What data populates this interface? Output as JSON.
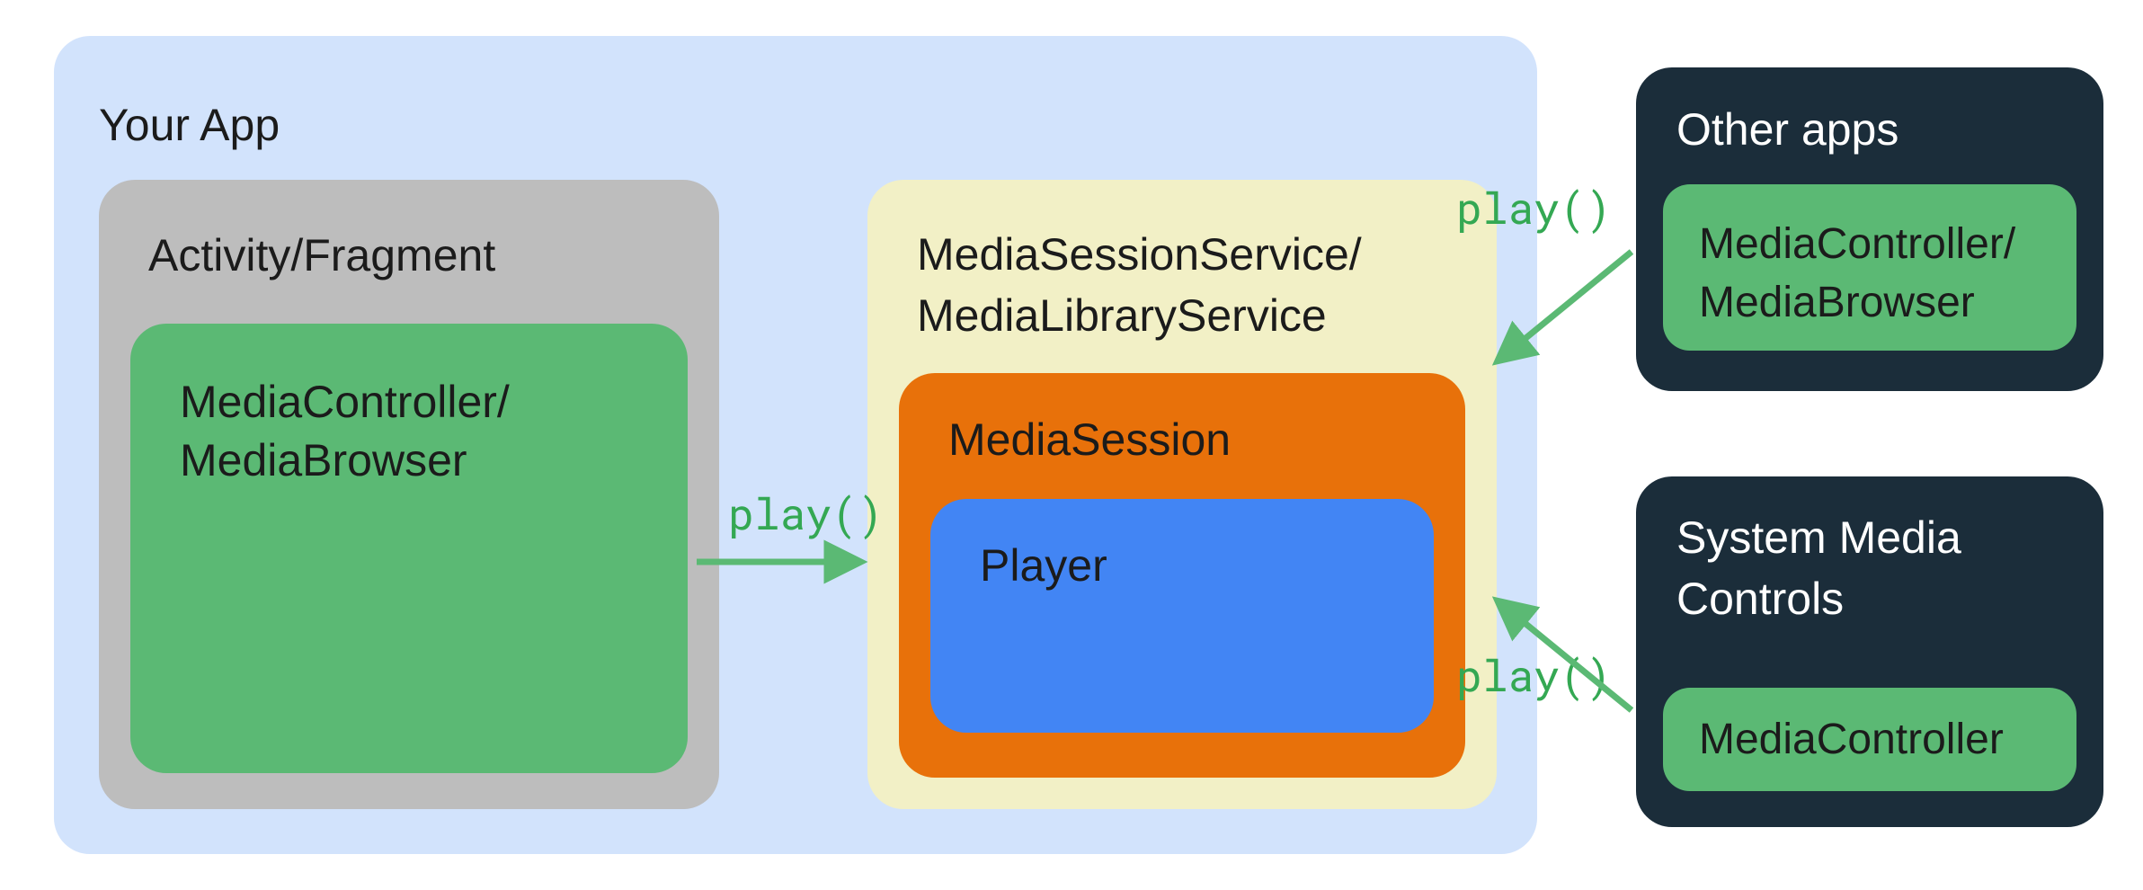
{
  "your_app": {
    "title": "Your App",
    "activity": {
      "title": "Activity/Fragment",
      "controller_label": "MediaController/\nMediaBrowser"
    },
    "service": {
      "title": "MediaSessionService/\nMediaLibraryService",
      "session_label": "MediaSession",
      "player_label": "Player"
    }
  },
  "other_apps": {
    "title": "Other apps",
    "controller_label": "MediaController/\nMediaBrowser"
  },
  "system_controls": {
    "title": "System Media\nControls",
    "controller_label": "MediaController"
  },
  "arrow_labels": {
    "left": "play()",
    "top_right": "play()",
    "bottom_right": "play()"
  },
  "colors": {
    "light_blue": "#d2e3fc",
    "grey": "#bdbdbd",
    "green_box": "#5bb974",
    "cream": "#f2f0c6",
    "orange": "#e8710a",
    "blue": "#4285f4",
    "dark": "#1b2d3a",
    "arrow": "#5bb974"
  }
}
